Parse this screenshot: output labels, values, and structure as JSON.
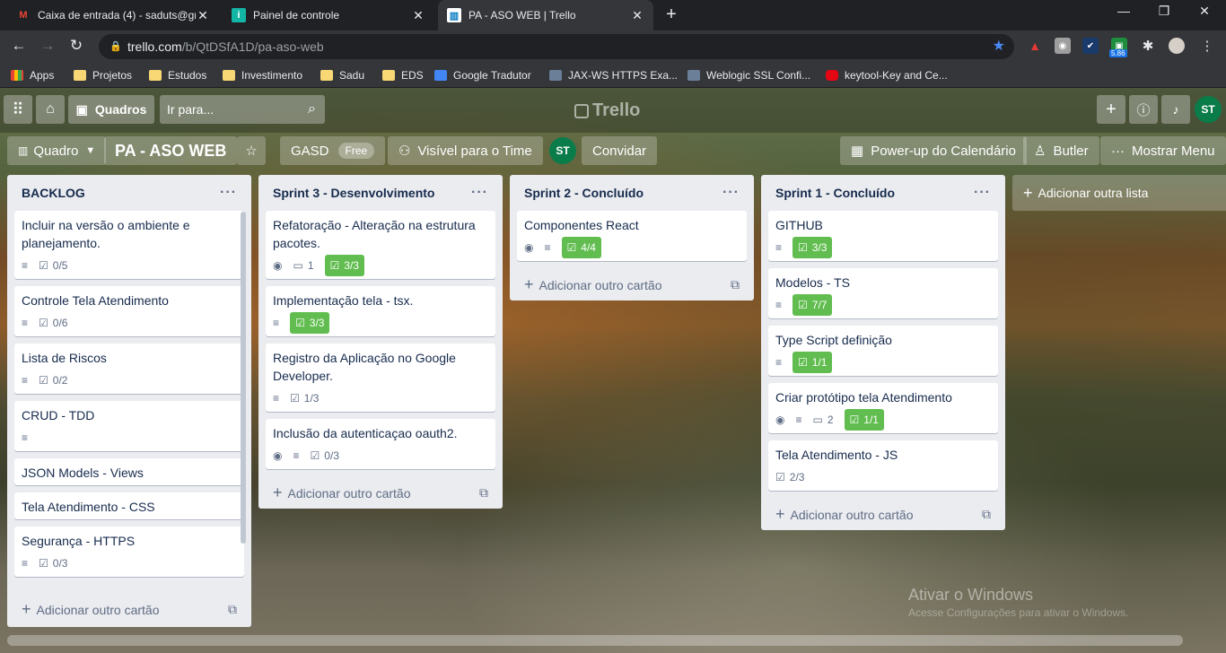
{
  "browser": {
    "tabs": [
      {
        "title": "Caixa de entrada (4) - saduts@gr",
        "icon": "gmail-icon",
        "icon_color": "#ea4335",
        "active": false
      },
      {
        "title": "Painel de controle",
        "icon": "panel-icon",
        "icon_color": "#13b5a5",
        "active": false
      },
      {
        "title": "PA - ASO WEB | Trello",
        "icon": "trello-icon",
        "icon_color": "#ffffff",
        "active": true
      }
    ],
    "url_host": "trello.com",
    "url_path": "/b/QtDSfA1D/pa-aso-web",
    "extension_badge": "5.86",
    "bookmarks": [
      {
        "label": "Apps",
        "icon": "apps-grid-icon"
      },
      {
        "label": "Projetos",
        "icon": "folder-icon"
      },
      {
        "label": "Estudos",
        "icon": "folder-icon"
      },
      {
        "label": "Investimento",
        "icon": "folder-icon"
      },
      {
        "label": "Sadu",
        "icon": "folder-icon"
      },
      {
        "label": "EDS",
        "icon": "folder-icon"
      },
      {
        "label": "Google Tradutor",
        "icon": "translate-icon"
      },
      {
        "label": "JAX-WS HTTPS Exa...",
        "icon": "link-icon"
      },
      {
        "label": "Weblogic SSL Confi...",
        "icon": "link-icon"
      },
      {
        "label": "keytool-Key and Ce...",
        "icon": "oracle-icon"
      }
    ]
  },
  "header": {
    "boards_label": "Quadros",
    "search_placeholder": "Ir para...",
    "logo": "Trello",
    "user_initials": "ST"
  },
  "board_bar": {
    "view_label": "Quadro",
    "board_title": "PA - ASO WEB",
    "team_name": "GASD",
    "team_plan": "Free",
    "visibility": "Visível para o Time",
    "member_initials": "ST",
    "invite": "Convidar",
    "calendar": "Power-up do Calendário",
    "butler": "Butler",
    "menu": "Mostrar Menu"
  },
  "lists": [
    {
      "title": "BACKLOG",
      "cards": [
        {
          "title": "Incluir na versão o ambiente e planejamento.",
          "desc": true,
          "checklist": "0/5",
          "done": false
        },
        {
          "title": "Controle Tela Atendimento",
          "desc": true,
          "checklist": "0/6",
          "done": false
        },
        {
          "title": "Lista de Riscos",
          "desc": true,
          "checklist": "0/2",
          "done": false
        },
        {
          "title": "CRUD - TDD",
          "desc": true
        },
        {
          "title": "JSON Models - Views"
        },
        {
          "title": "Tela Atendimento - CSS"
        },
        {
          "title": "Segurança - HTTPS",
          "desc": true,
          "checklist": "0/3",
          "done": false
        }
      ],
      "add_label": "Adicionar outro cartão"
    },
    {
      "title": "Sprint 3 - Desenvolvimento",
      "cards": [
        {
          "title": "Refatoração - Alteração na estrutura pacotes.",
          "watch": true,
          "comments": "1",
          "checklist": "3/3",
          "done": true
        },
        {
          "title": "Implementação tela - tsx.",
          "desc": true,
          "checklist": "3/3",
          "done": true
        },
        {
          "title": "Registro da Aplicação no Google Developer.",
          "desc": true,
          "checklist": "1/3",
          "done": false
        },
        {
          "title": "Inclusão da autenticaçao oauth2.",
          "watch": true,
          "desc": true,
          "checklist": "0/3",
          "done": false
        }
      ],
      "add_label": "Adicionar outro cartão"
    },
    {
      "title": "Sprint 2 - Concluído",
      "cards": [
        {
          "title": "Componentes React",
          "watch": true,
          "desc": true,
          "checklist": "4/4",
          "done": true
        }
      ],
      "add_label": "Adicionar outro cartão"
    },
    {
      "title": "Sprint 1 - Concluído",
      "cards": [
        {
          "title": "GITHUB",
          "desc": true,
          "checklist": "3/3",
          "done": true
        },
        {
          "title": "Modelos - TS",
          "desc": true,
          "checklist": "7/7",
          "done": true
        },
        {
          "title": "Type Script definição",
          "desc": true,
          "checklist": "1/1",
          "done": true
        },
        {
          "title": "Criar protótipo tela Atendimento",
          "watch": true,
          "desc": true,
          "comments": "2",
          "checklist": "1/1",
          "done": true
        },
        {
          "title": "Tela Atendimento - JS",
          "checklist": "2/3",
          "done": false
        }
      ],
      "add_label": "Adicionar outro cartão"
    }
  ],
  "add_list_label": "Adicionar outra lista",
  "watermark": "Ativar o Windows",
  "watermark_sub": "Acesse Configurações para ativar o Windows."
}
